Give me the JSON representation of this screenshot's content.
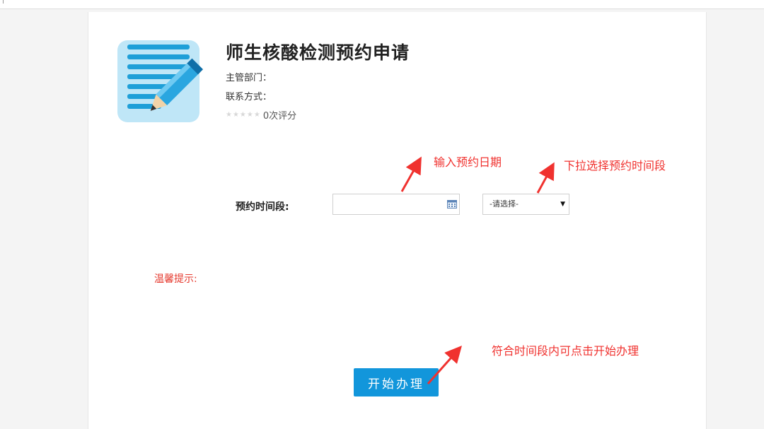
{
  "app": {
    "title": "师生核酸检测预约申请",
    "department_label": "主管部门：",
    "contact_label": "联系方式：",
    "rating_text": "0次评分",
    "rating_stars": "★★★★★"
  },
  "form": {
    "field_label": "预约时间段:",
    "date_value": "",
    "select_value": "-请选择-",
    "tip_label": "温馨提示:",
    "start_button": "开始办理"
  },
  "annotations": {
    "date_hint": "输入预约日期",
    "select_hint": "下拉选择预约时间段",
    "button_hint": "符合时间段内可点击开始办理"
  },
  "colors": {
    "annotation": "#f0322f",
    "button": "#1296db",
    "icon_blue": "#1e9fd8"
  },
  "icons": [
    "document-pencil-icon",
    "calendar-icon",
    "dropdown-arrow-icon",
    "star-icon"
  ]
}
